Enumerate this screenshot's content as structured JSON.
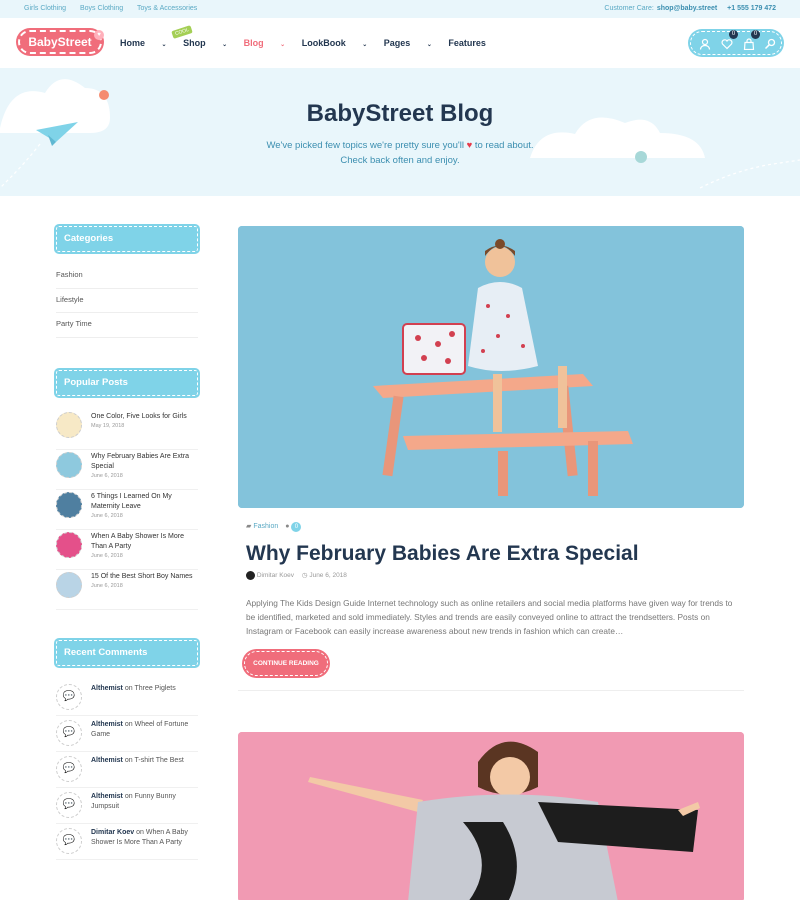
{
  "topbar": {
    "links": [
      "Girls Clothing",
      "Boys Clothing",
      "Toys & Accessories"
    ],
    "customer_care_label": "Customer Care:",
    "email": "shop@baby.street",
    "phone": "+1 555 179 472"
  },
  "header": {
    "logo": "BabyStreet",
    "nav": [
      {
        "label": "Home",
        "active": false
      },
      {
        "label": "Shop",
        "active": false
      },
      {
        "label": "Blog",
        "active": true
      },
      {
        "label": "LookBook",
        "active": false
      },
      {
        "label": "Pages",
        "active": false
      },
      {
        "label": "Features",
        "active": false
      }
    ],
    "shop_tag": "COOL",
    "wishlist_count": "0",
    "cart_count": "0"
  },
  "hero": {
    "title": "BabyStreet Blog",
    "subtitle_line1_a": "We've picked few topics we're pretty sure you'll",
    "subtitle_line1_b": "to read about.",
    "subtitle_line2": "Check back often and enjoy."
  },
  "sidebar": {
    "categories_title": "Categories",
    "categories": [
      "Fashion",
      "Lifestyle",
      "Party Time"
    ],
    "popular_title": "Popular Posts",
    "popular_posts": [
      {
        "title": "One Color, Five Looks for Girls",
        "date": "May 19, 2018"
      },
      {
        "title": "Why February Babies Are Extra Special",
        "date": "June 6, 2018"
      },
      {
        "title": "6 Things I Learned On My Maternity Leave",
        "date": "June 6, 2018"
      },
      {
        "title": "When A Baby Shower Is More Than A Party",
        "date": "June 6, 2018"
      },
      {
        "title": "15 Of the Best Short Boy Names",
        "date": "June 6, 2018"
      }
    ],
    "comments_title": "Recent Comments",
    "comments": [
      {
        "author": "Althemist",
        "on": "on",
        "post": "Three Piglets"
      },
      {
        "author": "Althemist",
        "on": "on",
        "post": "Wheel of Fortune Game"
      },
      {
        "author": "Althemist",
        "on": "on",
        "post": "T-shirt The Best"
      },
      {
        "author": "Althemist",
        "on": "on",
        "post": "Funny Bunny Jumpsuit"
      },
      {
        "author": "Dimitar Koev",
        "on": "on",
        "post": "When A Baby Shower Is More Than A Party"
      }
    ]
  },
  "post": {
    "category": "Fashion",
    "comment_count": "0",
    "title": "Why February Babies Are Extra Special",
    "author": "Dimitar Koev",
    "date": "June 6, 2018",
    "excerpt": "Applying The Kids Design Guide Internet technology such as online retailers and social media platforms have given way for trends to be identified, marketed and sold immediately. Styles and trends are easily conveyed online to attract the trendsetters. Posts on Instagram or Facebook can easily increase awareness about new trends in fashion which can create…",
    "read_more": "CONTINUE READING"
  },
  "colors": {
    "accent_pink": "#f06d7b",
    "accent_blue": "#7fd3e8",
    "navy": "#233750"
  }
}
